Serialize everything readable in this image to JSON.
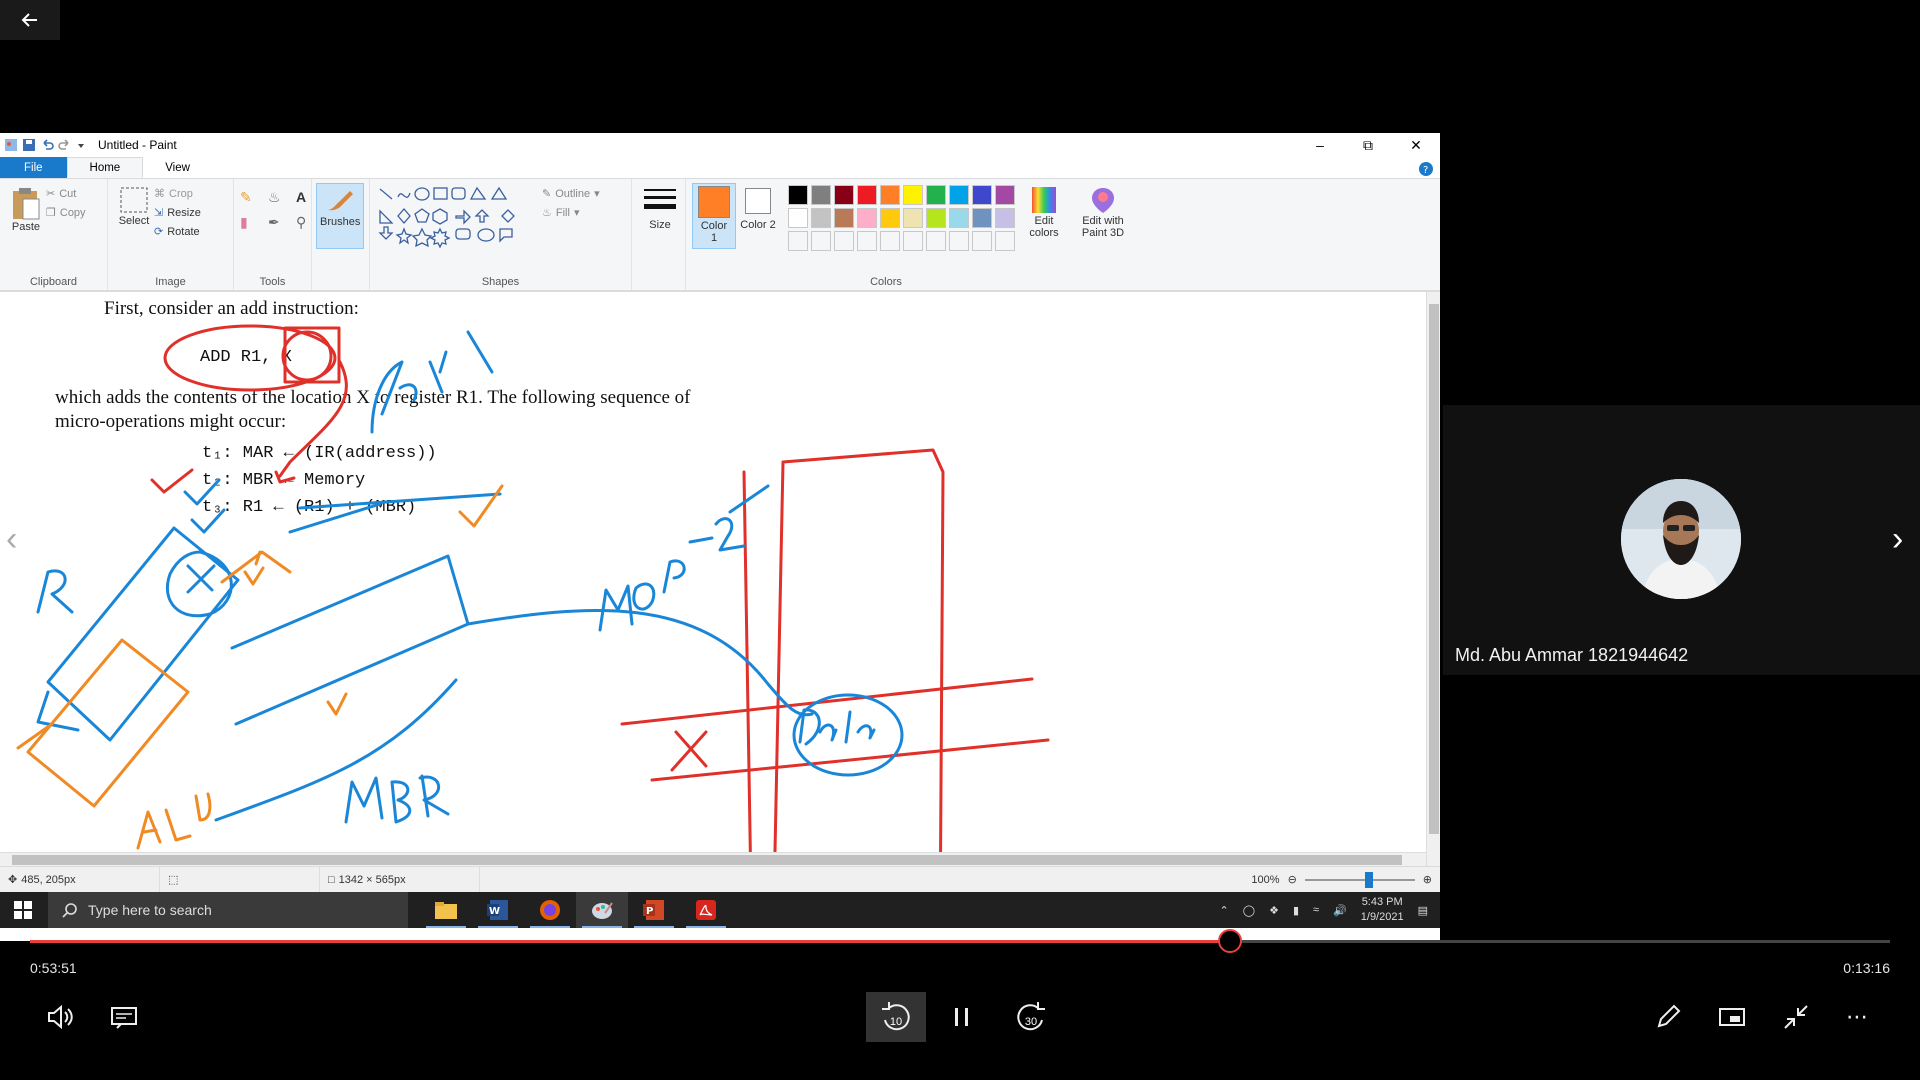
{
  "paint": {
    "window_title": "Untitled - Paint",
    "tabs": [
      "File",
      "Home",
      "View"
    ],
    "clipboard": {
      "paste": "Paste",
      "cut": "Cut",
      "copy": "Copy",
      "label": "Clipboard"
    },
    "image": {
      "select": "Select",
      "crop": "Crop",
      "resize": "Resize",
      "rotate": "Rotate",
      "label": "Image"
    },
    "tools": {
      "label": "Tools"
    },
    "brushes": "Brushes",
    "shapes": {
      "outline": "Outline",
      "fill": "Fill",
      "label": "Shapes"
    },
    "size": "Size",
    "color1": "Color 1",
    "color2": "Color 2",
    "colors_label": "Colors",
    "edit_colors": "Edit colors",
    "edit_paint3d": "Edit with Paint 3D",
    "palette_row1": [
      "#000000",
      "#7f7f7f",
      "#880015",
      "#ed1c24",
      "#ff7f27",
      "#fff200",
      "#22b14c",
      "#00a2e8",
      "#3f48cc",
      "#a349a4"
    ],
    "palette_row2": [
      "#ffffff",
      "#c3c3c3",
      "#b97a57",
      "#ffaec9",
      "#ffc90e",
      "#efe4b0",
      "#b5e61d",
      "#99d9ea",
      "#7092be",
      "#c8bfe7"
    ],
    "status": {
      "position": "485, 205px",
      "dimensions": "1342 × 565px",
      "zoom": "100%"
    }
  },
  "document": {
    "line1": "First, consider an add instruction:",
    "instruction": "ADD R1, X",
    "line2": "which adds the contents of the location X to register R1. The following sequence of",
    "line3": "micro-operations might occur:",
    "t1": "t₁: MAR ← (IR(address))",
    "t2": "t₂: MBR ← Memory",
    "t3": "t₃: R1 ← (R1) + (MBR)",
    "annotations": [
      "Mop-1",
      "MOP-2",
      "MBR",
      "ALU",
      "R",
      "X",
      "Data",
      "X"
    ]
  },
  "taskbar": {
    "search_placeholder": "Type here to search",
    "time": "5:43 PM",
    "date": "1/9/2021"
  },
  "participant": {
    "name": "Md. Abu Ammar 1821944642"
  },
  "player": {
    "elapsed": "0:53:51",
    "remaining": "0:13:16",
    "progress_fraction": 0.645,
    "skip_back": "10",
    "skip_forward": "30"
  }
}
